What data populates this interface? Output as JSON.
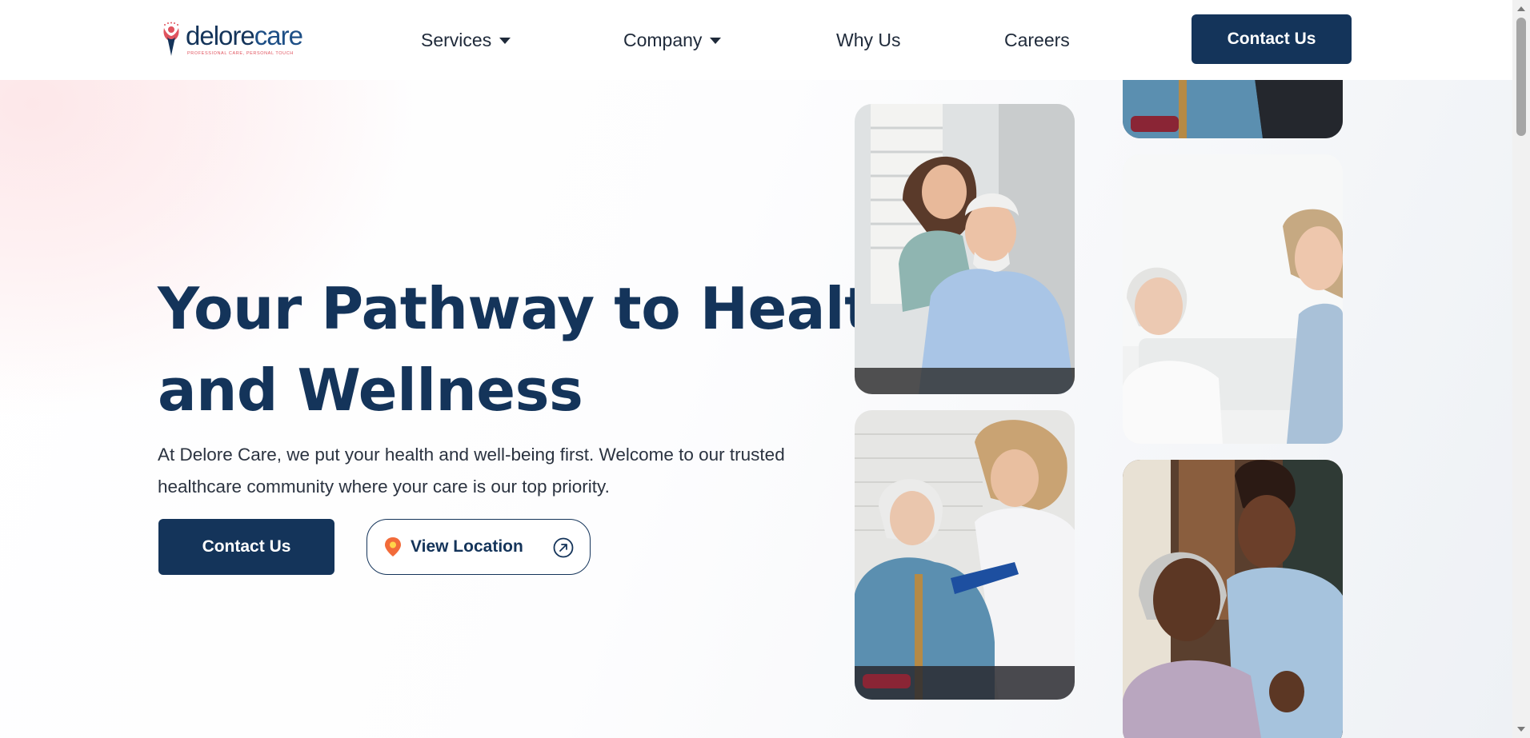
{
  "header": {
    "logo": {
      "word_first": "delore",
      "word_second": "care",
      "tagline": "PROFESSIONAL CARE, PERSONAL TOUCH"
    },
    "nav": {
      "services": "Services",
      "company": "Company",
      "why_us": "Why Us",
      "careers": "Careers"
    },
    "contact_label": "Contact Us"
  },
  "hero": {
    "title_line1": "Your Pathway to Health",
    "title_line2": "and Wellness",
    "desc_line1": "At Delore Care, we put your health and well-being first. Welcome to our trusted",
    "desc_line2": "healthcare community where your care is our top priority.",
    "contact_label": "Contact Us",
    "location_label": "View Location"
  },
  "colors": {
    "brand_navy": "#14345a",
    "brand_coral": "#e0535e",
    "location_pin": "#f26b3a"
  },
  "icons": [
    "logo-mark-icon",
    "caret-down-icon",
    "location-pin-icon",
    "arrow-up-right-circle-icon"
  ]
}
